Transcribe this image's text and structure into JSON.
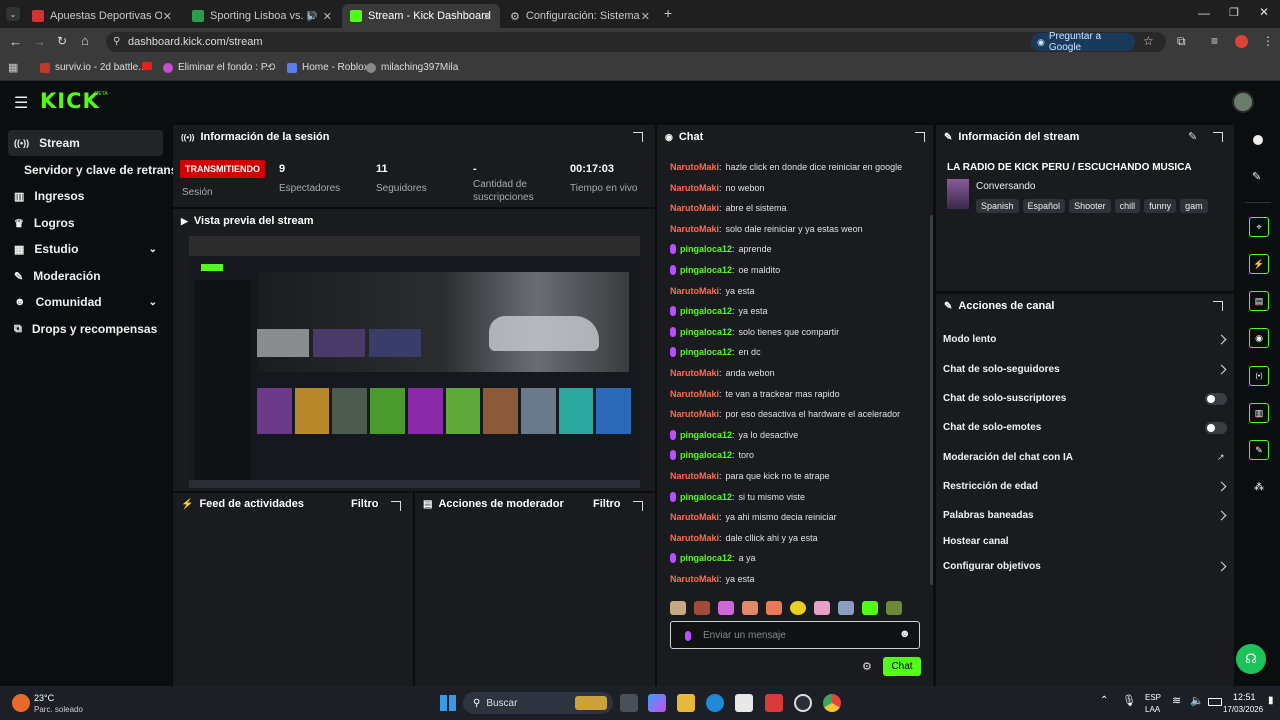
{
  "browser": {
    "tabs": [
      {
        "label": "Apuestas Deportivas Online | A",
        "color": "#d23232"
      },
      {
        "label": "Sporting Lisboa vs. FK Bodø",
        "color": "#2a9d4a"
      },
      {
        "label": "Stream - Kick Dashboard",
        "color": "#53fc18"
      },
      {
        "label": "Configuración: Sistema",
        "color": "#9aa0a6"
      }
    ],
    "url": "dashboard.kick.com/stream",
    "ask_google": "Preguntar a Google",
    "bookmarks": [
      "surviv.io - 2d battle...",
      "Eliminar el fondo : P...",
      "Home - Roblox",
      "milaching397Mila"
    ]
  },
  "app": {
    "logo": "KICK",
    "logo_sup": "BETA",
    "accent": "#53fc18"
  },
  "sidebar": {
    "items": [
      {
        "label": "Stream",
        "icon": "broadcast-icon"
      },
      {
        "label": "Servidor y clave de retransm",
        "icon": ""
      },
      {
        "label": "Ingresos",
        "icon": "bank-icon"
      },
      {
        "label": "Logros",
        "icon": "trophy-icon"
      },
      {
        "label": "Estudio",
        "icon": "grid-icon"
      },
      {
        "label": "Moderación",
        "icon": "wrench-icon"
      },
      {
        "label": "Comunidad",
        "icon": "people-icon"
      },
      {
        "label": "Drops y recompensas",
        "icon": "gift-icon"
      }
    ]
  },
  "session": {
    "title": "Información de la sesión",
    "status_badge": "TRANSMITIENDO",
    "status_label": "Sesión",
    "stats": [
      {
        "value": "9",
        "label": "Espectadores"
      },
      {
        "value": "11",
        "label": "Seguidores"
      },
      {
        "value": "-",
        "label": "Cantidad de suscripciones"
      },
      {
        "value": "00:17:03",
        "label": "Tiempo en vivo"
      }
    ]
  },
  "preview": {
    "title": "Vista previa del stream"
  },
  "feed": {
    "title": "Feed de actividades",
    "filter": "Filtro"
  },
  "mod_actions": {
    "title": "Acciones de moderador",
    "filter": "Filtro"
  },
  "chat": {
    "title": "Chat",
    "messages": [
      {
        "user": "NarutoMaki",
        "text": "hazle click en donde dice reiniciar en google",
        "mic": false
      },
      {
        "user": "NarutoMaki",
        "text": "no webon",
        "mic": false
      },
      {
        "user": "NarutoMaki",
        "text": "abre el sistema",
        "mic": false
      },
      {
        "user": "NarutoMaki",
        "text": "solo dale reiniciar y ya estas weon",
        "mic": false
      },
      {
        "user": "pingaloca12",
        "text": "aprende",
        "mic": true
      },
      {
        "user": "pingaloca12",
        "text": "oe maldito",
        "mic": true
      },
      {
        "user": "NarutoMaki",
        "text": "ya esta",
        "mic": false
      },
      {
        "user": "pingaloca12",
        "text": "ya esta",
        "mic": true
      },
      {
        "user": "pingaloca12",
        "text": "solo tienes que compartir",
        "mic": true
      },
      {
        "user": "pingaloca12",
        "text": "en dc",
        "mic": true
      },
      {
        "user": "NarutoMaki",
        "text": "anda webon",
        "mic": false
      },
      {
        "user": "NarutoMaki",
        "text": "te van a trackear mas rapido",
        "mic": false
      },
      {
        "user": "NarutoMaki",
        "text": "por eso desactiva el hardware el acelerador",
        "mic": false
      },
      {
        "user": "pingaloca12",
        "text": "ya lo desactive",
        "mic": true
      },
      {
        "user": "pingaloca12",
        "text": "toro",
        "mic": true
      },
      {
        "user": "NarutoMaki",
        "text": "para que kick no te atrape",
        "mic": false
      },
      {
        "user": "pingaloca12",
        "text": "si tu mismo viste",
        "mic": true
      },
      {
        "user": "NarutoMaki",
        "text": "ya ahi mismo decia reiniciar",
        "mic": false
      },
      {
        "user": "NarutoMaki",
        "text": "dale cllick ahi y ya esta",
        "mic": false
      },
      {
        "user": "pingaloca12",
        "text": "a ya",
        "mic": true
      },
      {
        "user": "NarutoMaki",
        "text": "ya esta",
        "mic": false
      }
    ],
    "user_colors": {
      "NarutoMaki": "#ff6b4a",
      "pingaloca12": "#53fc18"
    },
    "input_placeholder": "Enviar un mensaje",
    "send_label": "Chat"
  },
  "stream_info": {
    "title": "Información del stream",
    "stream_title": "LA RADIO DE KICK PERU / ESCUCHANDO MUSICA",
    "category": "Conversando",
    "tags": [
      "Spanish",
      "Español",
      "Shooter",
      "chill",
      "funny",
      "gam"
    ]
  },
  "channel_actions": {
    "title": "Acciones de canal",
    "items": [
      {
        "label": "Modo lento",
        "control": "chevron"
      },
      {
        "label": "Chat de solo-seguidores",
        "control": "chevron"
      },
      {
        "label": "Chat de solo-suscriptores",
        "control": "toggle"
      },
      {
        "label": "Chat de solo-emotes",
        "control": "toggle"
      },
      {
        "label": "Moderación del chat con IA",
        "control": "external"
      },
      {
        "label": "Restricción de edad",
        "control": "chevron"
      },
      {
        "label": "Palabras baneadas",
        "control": "chevron"
      },
      {
        "label": "Hostear canal",
        "control": "none"
      },
      {
        "label": "Configurar objetivos",
        "control": "chevron"
      }
    ]
  },
  "taskbar": {
    "temp": "23°C",
    "weather": "Parc. soleado",
    "search": "Buscar",
    "lang": "ESP",
    "lang2": "LAA",
    "time": "12:51",
    "date": "17/03/2026"
  }
}
